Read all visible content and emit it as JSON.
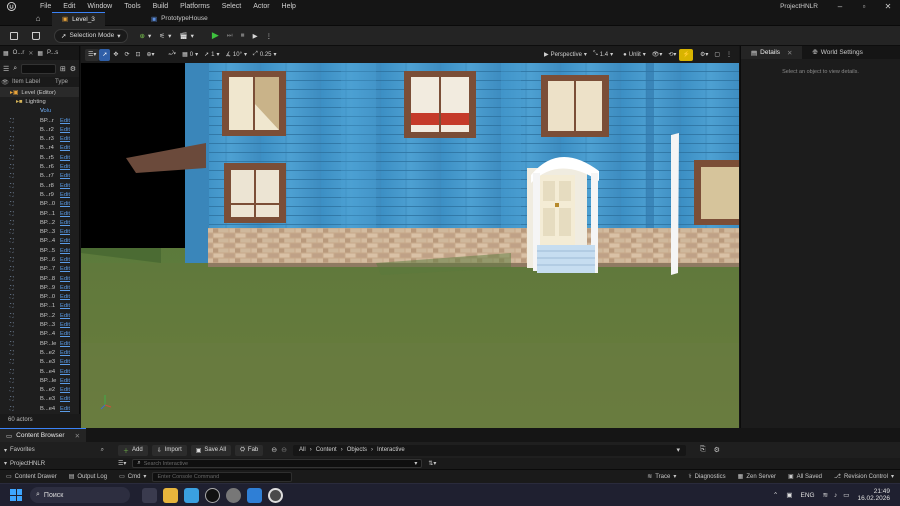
{
  "menubar": {
    "items": [
      "File",
      "Edit",
      "Window",
      "Tools",
      "Build",
      "Platforms",
      "Select",
      "Actor",
      "Help"
    ],
    "project_name": "ProjectHNLR"
  },
  "tabs": [
    {
      "label": "Level_3"
    },
    {
      "label": "PrototypeHouse"
    }
  ],
  "toolbar": {
    "selection_mode": "Selection Mode"
  },
  "outliner": {
    "tab_label": "O...r",
    "tab2_label": "P...s",
    "col_label": "Item Label",
    "col_type": "Type",
    "level_row": "Level (Editor)",
    "lighting_row": "Lighting",
    "vol_row": "V...e",
    "vol_type": "Volu",
    "rows": [
      {
        "name": "BP...r",
        "type": "Edit"
      },
      {
        "name": "B...r2",
        "type": "Edit"
      },
      {
        "name": "B...r3",
        "type": "Edit"
      },
      {
        "name": "B...r4",
        "type": "Edit"
      },
      {
        "name": "B...r5",
        "type": "Edit"
      },
      {
        "name": "B...r6",
        "type": "Edit"
      },
      {
        "name": "B...r7",
        "type": "Edit"
      },
      {
        "name": "B...r8",
        "type": "Edit"
      },
      {
        "name": "B...r9",
        "type": "Edit"
      },
      {
        "name": "BP...0",
        "type": "Edit"
      },
      {
        "name": "BP...1",
        "type": "Edit"
      },
      {
        "name": "BP...2",
        "type": "Edit"
      },
      {
        "name": "BP...3",
        "type": "Edit"
      },
      {
        "name": "BP...4",
        "type": "Edit"
      },
      {
        "name": "BP...5",
        "type": "Edit"
      },
      {
        "name": "BP...6",
        "type": "Edit"
      },
      {
        "name": "BP...7",
        "type": "Edit"
      },
      {
        "name": "BP...8",
        "type": "Edit"
      },
      {
        "name": "BP...9",
        "type": "Edit"
      },
      {
        "name": "BP...0",
        "type": "Edit"
      },
      {
        "name": "BP...1",
        "type": "Edit"
      },
      {
        "name": "BP...2",
        "type": "Edit"
      },
      {
        "name": "BP...3",
        "type": "Edit"
      },
      {
        "name": "BP...4",
        "type": "Edit"
      },
      {
        "name": "BP...le",
        "type": "Edit"
      },
      {
        "name": "B...e2",
        "type": "Edit"
      },
      {
        "name": "B...e3",
        "type": "Edit"
      },
      {
        "name": "B...e4",
        "type": "Edit"
      },
      {
        "name": "BP...le",
        "type": "Edit"
      },
      {
        "name": "B...e2",
        "type": "Edit"
      },
      {
        "name": "B...e3",
        "type": "Edit"
      },
      {
        "name": "B...e4",
        "type": "Edit"
      }
    ],
    "actor_count": "60 actors"
  },
  "viewport": {
    "rotate_value": "0",
    "grid_value": "1",
    "angle_value": "10°",
    "scale_value": "0.25",
    "view_mode": "Perspective",
    "camera_speed": "1.4",
    "lighting_mode": "Unlit"
  },
  "details": {
    "tab_details": "Details",
    "tab_world": "World Settings",
    "empty_hint": "Select an object to view details."
  },
  "content_browser": {
    "tab_label": "Content Browser",
    "add": "Add",
    "import": "Import",
    "save_all": "Save All",
    "fab": "Fab",
    "breadcrumb": [
      "All",
      "Content",
      "Objects",
      "Interactive"
    ],
    "favorites": "Favorites",
    "project": "ProjectHNLR",
    "search_placeholder": "Search Interactive"
  },
  "statusbar": {
    "content_drawer": "Content Drawer",
    "output_log": "Output Log",
    "cmd": "Cmd",
    "console_placeholder": "Enter Console Command",
    "trace": "Trace",
    "diagnostics": "Diagnostics",
    "zen_server": "Zen Server",
    "all_saved": "All Saved",
    "revision_control": "Revision Control"
  },
  "taskbar": {
    "search": "Поиск",
    "lang": "ENG",
    "time": "21:49",
    "date": "16.02.2026"
  }
}
